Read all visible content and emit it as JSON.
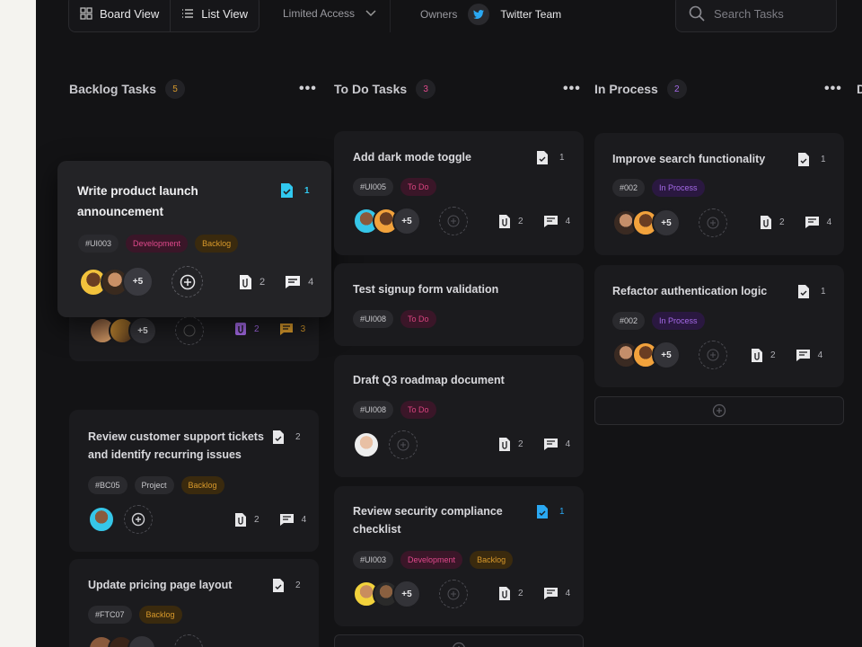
{
  "topbar": {
    "board_view": "Board View",
    "list_view": "List View",
    "access": "Limited Access",
    "owners_label": "Owners",
    "owner_team": "Twitter Team",
    "search_placeholder": "Search Tasks"
  },
  "columns": [
    {
      "title": "Backlog Tasks",
      "count": "5",
      "count_color": "#d99a2b"
    },
    {
      "title": "To Do Tasks",
      "count": "3",
      "count_color": "#e0498c"
    },
    {
      "title": "In Process",
      "count": "2",
      "count_color": "#a56ae8"
    },
    {
      "title": "D",
      "count": ""
    }
  ],
  "backlog": {
    "dragged": {
      "title": "Write product launch announcement",
      "tags": [
        "#UI003",
        "Development",
        "Backlog"
      ],
      "more": "+5",
      "checks": "1",
      "files": "2",
      "comments": "4"
    },
    "behind": {
      "more": "+5",
      "files": "2",
      "comments": "3"
    },
    "card2": {
      "title": "Review customer support tickets and identify recurring issues",
      "tags": [
        "#BC05",
        "Project",
        "Backlog"
      ],
      "checks": "2",
      "files": "2",
      "comments": "4"
    },
    "card3": {
      "title": "Update pricing page layout",
      "tags": [
        "#FTC07",
        "Backlog"
      ],
      "checks": "2"
    }
  },
  "todo": {
    "card1": {
      "title": "Add dark mode toggle",
      "tags": [
        "#UI005",
        "To Do"
      ],
      "more": "+5",
      "checks": "1",
      "files": "2",
      "comments": "4"
    },
    "card2": {
      "title": "Test signup form validation",
      "tags": [
        "#UI008",
        "To Do"
      ]
    },
    "card3": {
      "title": "Draft Q3 roadmap document",
      "tags": [
        "#UI008",
        "To Do"
      ],
      "files": "2",
      "comments": "4"
    },
    "card4": {
      "title": "Review security compliance checklist",
      "tags": [
        "#UI003",
        "Development",
        "Backlog"
      ],
      "more": "+5",
      "checks": "1",
      "files": "2",
      "comments": "4"
    }
  },
  "process": {
    "card1": {
      "title": "Improve search functionality",
      "tags": [
        "#002",
        "In Process"
      ],
      "more": "+5",
      "checks": "1",
      "files": "2",
      "comments": "4"
    },
    "card2": {
      "title": "Refactor authentication logic",
      "tags": [
        "#002",
        "In Process"
      ],
      "more": "+5",
      "checks": "1",
      "files": "2",
      "comments": "4"
    }
  },
  "colors": {
    "background": "#131315",
    "card": "#1b1b1e",
    "accent_blue": "#2aa8f2",
    "accent_cyan": "#31c9f0"
  }
}
